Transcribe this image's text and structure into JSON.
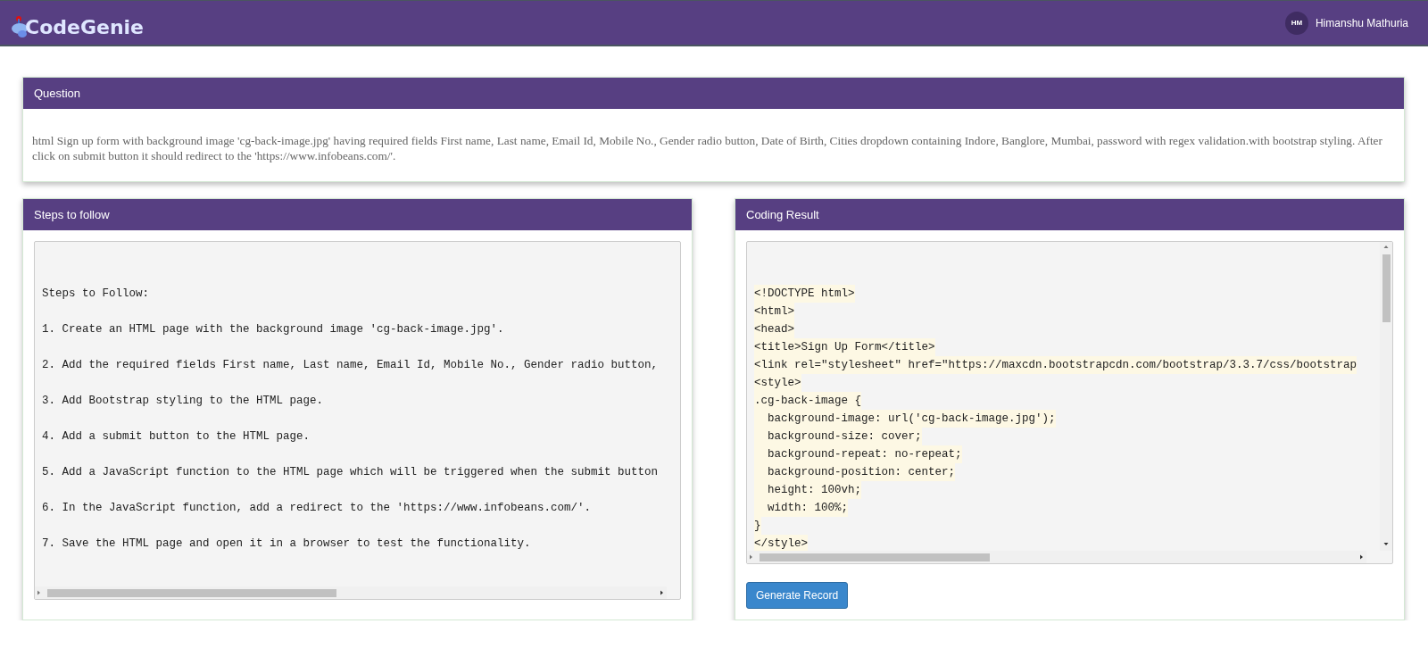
{
  "header": {
    "brand": "CodeGenie",
    "user": {
      "initials": "HM",
      "name": "Himanshu Mathuria"
    }
  },
  "question": {
    "title": "Question",
    "text": "html Sign up form with background image 'cg-back-image.jpg' having required fields First name, Last name, Email Id, Mobile No., Gender radio button, Date of Birth, Cities dropdown containing Indore, Banglore, Mumbai, password with regex validation.with bootstrap styling. After click on submit button it should redirect to the 'https://www.infobeans.com/'."
  },
  "steps": {
    "title": "Steps to follow",
    "lines": [
      "Steps to Follow:",
      "1. Create an HTML page with the background image 'cg-back-image.jpg'.",
      "2. Add the required fields First name, Last name, Email Id, Mobile No., Gender radio button,",
      "3. Add Bootstrap styling to the HTML page.",
      "4. Add a submit button to the HTML page.",
      "5. Add a JavaScript function to the HTML page which will be triggered when the submit button",
      "6. In the JavaScript function, add a redirect to the 'https://www.infobeans.com/'.",
      "7. Save the HTML page and open it in a browser to test the functionality."
    ]
  },
  "result": {
    "title": "Coding Result",
    "lines": [
      "<!DOCTYPE html>",
      "<html>",
      "<head>",
      "<title>Sign Up Form</title>",
      "<link rel=\"stylesheet\" href=\"https://maxcdn.bootstrapcdn.com/bootstrap/3.3.7/css/bootstrap",
      "<style>",
      ".cg-back-image {",
      "  background-image: url('cg-back-image.jpg');",
      "  background-size: cover;",
      "  background-repeat: no-repeat;",
      "  background-position: center;",
      "  height: 100vh;",
      "  width: 100%;",
      "}",
      "</style>"
    ],
    "button": "Generate Record"
  }
}
